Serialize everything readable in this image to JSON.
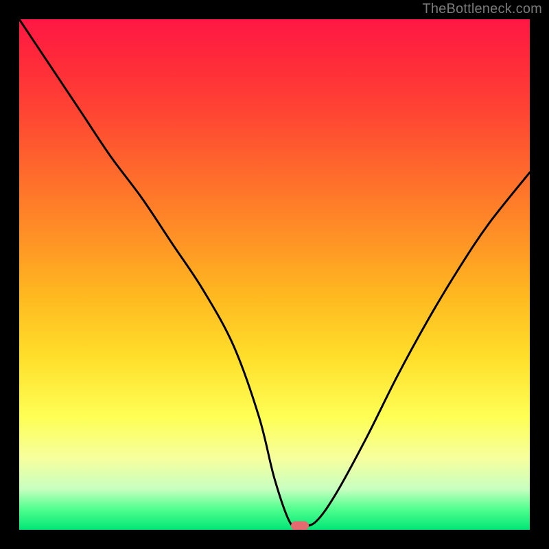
{
  "watermark": "TheBottleneck.com",
  "colors": {
    "frame_bg": "#000000",
    "curve_stroke": "#000000",
    "marker_fill": "#e46a6f",
    "gradient_top": "#ff1744",
    "gradient_bottom": "#00e676",
    "watermark_color": "#7a7a7a"
  },
  "chart_data": {
    "type": "line",
    "title": "",
    "xlabel": "",
    "ylabel": "",
    "xlim": [
      0,
      100
    ],
    "ylim": [
      0,
      100
    ],
    "grid": false,
    "legend": false,
    "background": "rainbow-vertical (red=high bottleneck at top, green=low bottleneck at bottom)",
    "series": [
      {
        "name": "bottleneck-curve",
        "x": [
          0,
          6,
          12,
          18,
          24,
          30,
          36,
          42,
          47,
          50,
          53,
          55,
          58,
          62,
          68,
          74,
          80,
          86,
          92,
          100
        ],
        "y": [
          100,
          91,
          82,
          73,
          65,
          56,
          47,
          36,
          22,
          10,
          1.5,
          0.8,
          1.5,
          7,
          18,
          30,
          41,
          51,
          60,
          70
        ]
      }
    ],
    "marker": {
      "x": 55,
      "y": 0.8,
      "shape": "pill",
      "color": "#e46a6f"
    }
  }
}
